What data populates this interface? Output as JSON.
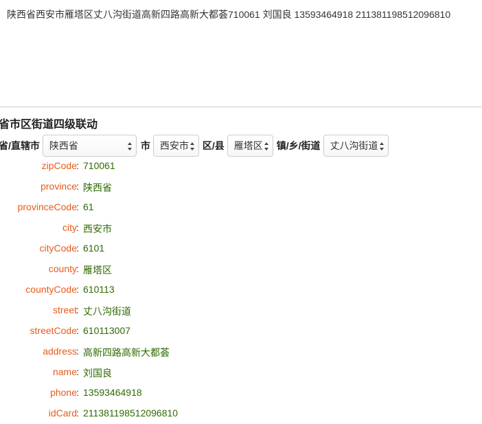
{
  "textarea": {
    "value": "陕西省西安市雁塔区丈八沟街道高新四路高新大都荟710061 刘国良 13593464918 211381198512096810"
  },
  "section": {
    "title": "省市区街道四级联动"
  },
  "selects": {
    "province_label": "省/直辖市",
    "province_value": "陕西省",
    "city_label": "市",
    "city_value": "西安市",
    "county_label": "区/县",
    "county_value": "雁塔区",
    "street_label": "镇/乡/街道",
    "street_value": "丈八沟街道"
  },
  "fields": [
    {
      "key": "zipCode",
      "value": "710061"
    },
    {
      "key": "province",
      "value": "陕西省"
    },
    {
      "key": "provinceCode",
      "value": "61"
    },
    {
      "key": "city",
      "value": "西安市"
    },
    {
      "key": "cityCode",
      "value": "6101"
    },
    {
      "key": "county",
      "value": "雁塔区"
    },
    {
      "key": "countyCode",
      "value": "610113"
    },
    {
      "key": "street",
      "value": "丈八沟街道"
    },
    {
      "key": "streetCode",
      "value": "610113007"
    },
    {
      "key": "address",
      "value": "高新四路高新大都荟"
    },
    {
      "key": "name",
      "value": "刘国良"
    },
    {
      "key": "phone",
      "value": "13593464918"
    },
    {
      "key": "idCard",
      "value": "211381198512096810"
    }
  ],
  "colors": {
    "key": "#e85a1b",
    "value": "#2f6a00",
    "divider": "#cfcfcf"
  }
}
